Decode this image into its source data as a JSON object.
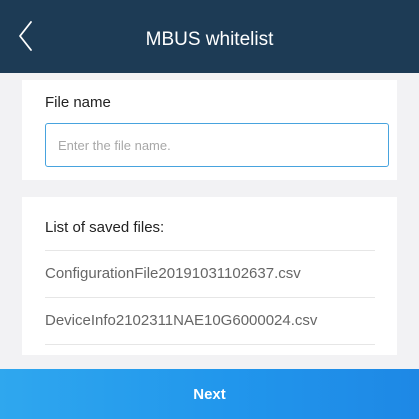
{
  "header": {
    "title": "MBUS whitelist",
    "back_icon": "chevron-left-icon"
  },
  "file_name": {
    "label": "File name",
    "value": "",
    "placeholder": "Enter the file name."
  },
  "saved_files": {
    "title": "List of saved files:",
    "items": [
      "ConfigurationFile20191031102637.csv",
      "DeviceInfo2102311NAE10G6000024.csv"
    ]
  },
  "footer": {
    "next_label": "Next"
  },
  "colors": {
    "header_background": "#1d3b55",
    "accent": "#2196ec",
    "page_background": "#f2f2f4"
  }
}
